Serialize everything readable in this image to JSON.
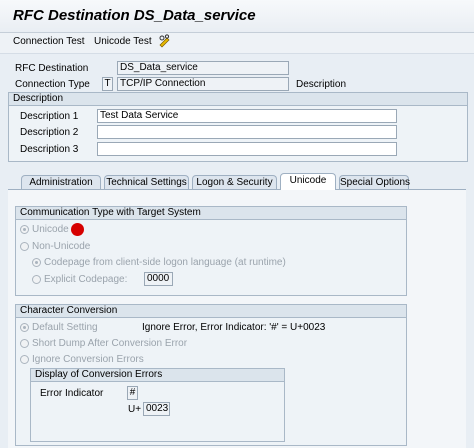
{
  "window": {
    "title": "RFC Destination DS_Data_service"
  },
  "toolbar": {
    "connection_test": "Connection Test",
    "unicode_test": "Unicode Test",
    "extra_icon": "pencil-glasses-icon"
  },
  "header": {
    "rfc_destination_label": "RFC Destination",
    "rfc_destination_value": "DS_Data_service",
    "connection_type_label": "Connection Type",
    "connection_type_code": "T",
    "connection_type_value": "TCP/IP Connection",
    "description_label": "Description"
  },
  "description_group": {
    "title": "Description",
    "d1_label": "Description 1",
    "d1_value": "Test Data Service",
    "d2_label": "Description 2",
    "d2_value": "",
    "d3_label": "Description 3",
    "d3_value": ""
  },
  "tabs": [
    {
      "label": "Administration"
    },
    {
      "label": "Technical Settings"
    },
    {
      "label": "Logon & Security"
    },
    {
      "label": "Unicode"
    },
    {
      "label": "Special Options"
    }
  ],
  "comm_type": {
    "title": "Communication Type with Target System",
    "unicode": "Unicode",
    "non_unicode": "Non-Unicode",
    "codepage_logon": "Codepage from client-side logon language (at runtime)",
    "explicit_codepage": "Explicit Codepage:",
    "explicit_codepage_value": "0000"
  },
  "char_conv": {
    "title": "Character Conversion",
    "default_setting": "Default Setting",
    "ignore_error_text": "Ignore Error, Error Indicator: '#' = U+0023",
    "short_dump": "Short Dump After Conversion Error",
    "ignore_errors": "Ignore Conversion Errors",
    "display_title": "Display of Conversion Errors",
    "error_indicator_label": "Error Indicator",
    "error_indicator_value": "#",
    "u_prefix": "U+",
    "u_value": "0023"
  },
  "colors": {
    "accent_red": "#d60000",
    "group_border": "#a9b8c7"
  }
}
